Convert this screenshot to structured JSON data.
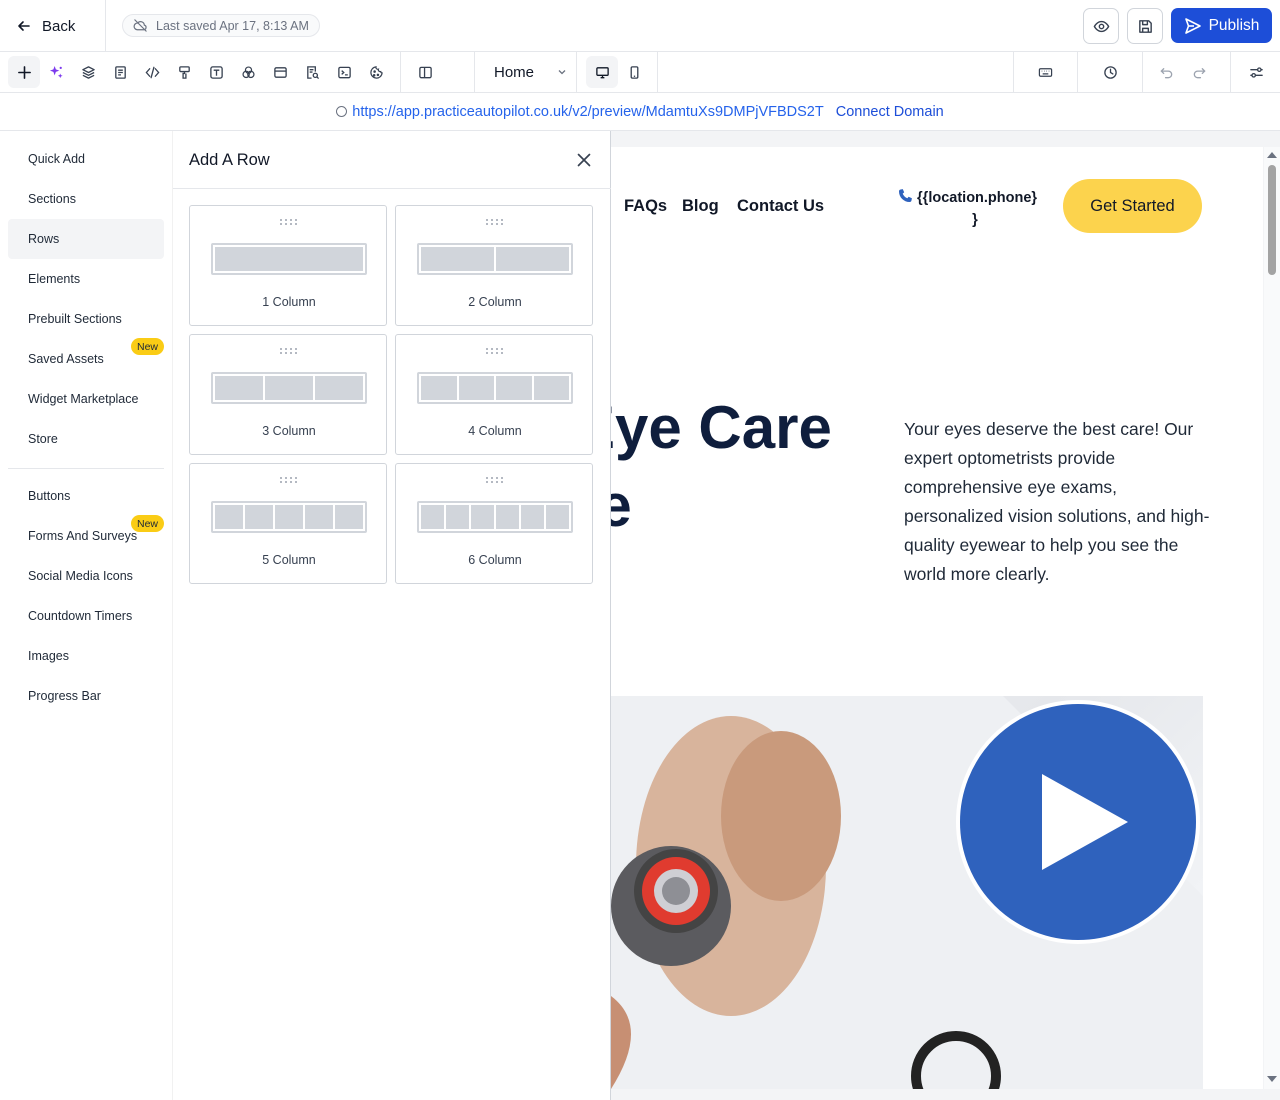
{
  "header": {
    "back_label": "Back",
    "saved_status": "Last saved Apr 17, 8:13 AM",
    "publish_label": "Publish"
  },
  "toolbar": {
    "page_selected": "Home"
  },
  "urlbar": {
    "url": "https://app.practiceautopilot.co.uk/v2/preview/MdamtuXs9DMPjVFBDS2T",
    "connect_label": "Connect Domain"
  },
  "sidebar": {
    "items": [
      {
        "label": "Quick Add"
      },
      {
        "label": "Sections"
      },
      {
        "label": "Rows"
      },
      {
        "label": "Elements"
      },
      {
        "label": "Prebuilt Sections"
      },
      {
        "label": "Saved Assets",
        "badge": "New"
      },
      {
        "label": "Widget Marketplace"
      },
      {
        "label": "Store"
      },
      {
        "label": "Buttons"
      },
      {
        "label": "Forms And Surveys",
        "badge": "New"
      },
      {
        "label": "Social Media Icons"
      },
      {
        "label": "Countdown Timers"
      },
      {
        "label": "Images"
      },
      {
        "label": "Progress Bar"
      }
    ],
    "active": "Rows"
  },
  "panel": {
    "title": "Add A Row",
    "rows": [
      {
        "label": "1 Column"
      },
      {
        "label": "2 Column"
      },
      {
        "label": "3 Column"
      },
      {
        "label": "4 Column"
      },
      {
        "label": "5 Column"
      },
      {
        "label": "6 Column"
      }
    ]
  },
  "site": {
    "nav": [
      "FAQs",
      "Blog",
      "Contact Us"
    ],
    "phone_line1": "{{location.phone}",
    "phone_line2": "}",
    "cta_label": "Get Started",
    "hero_line1": "Eye Care",
    "hero_line2": "re",
    "hero_description": "Your eyes deserve the best care! Our expert optometrists provide comprehensive eye exams, personalized vision solutions, and high-quality eyewear to help you see the world more clearly."
  },
  "colors": {
    "accent": "#1d4ed8",
    "cta": "#fcd34d",
    "play": "#2f62bd",
    "badge": "#facc15",
    "hero_text": "#0f1e3d"
  }
}
